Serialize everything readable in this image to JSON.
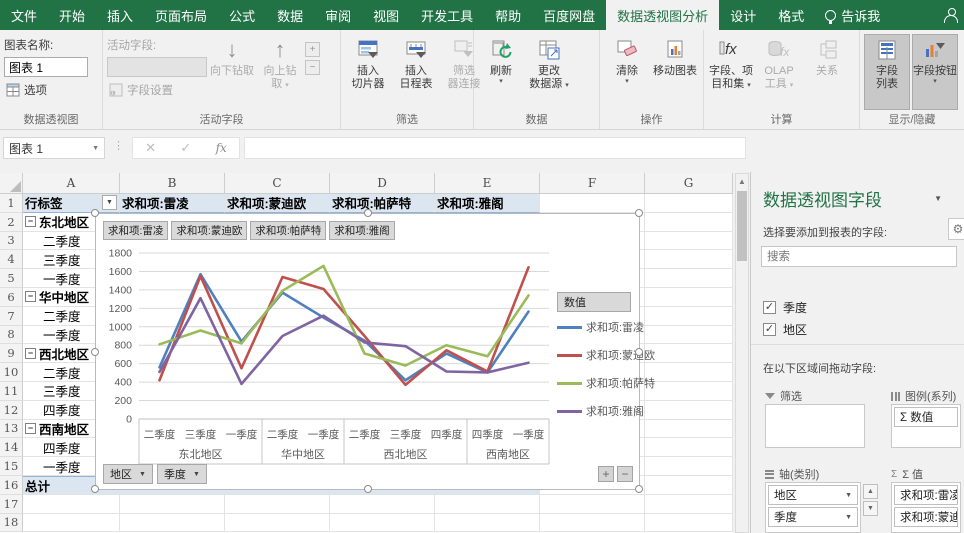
{
  "titlebar": {
    "tabs": [
      {
        "label": "文件",
        "active": false
      },
      {
        "label": "开始",
        "active": false
      },
      {
        "label": "插入",
        "active": false
      },
      {
        "label": "页面布局",
        "active": false
      },
      {
        "label": "公式",
        "active": false
      },
      {
        "label": "数据",
        "active": false
      },
      {
        "label": "审阅",
        "active": false
      },
      {
        "label": "视图",
        "active": false
      },
      {
        "label": "开发工具",
        "active": false
      },
      {
        "label": "帮助",
        "active": false
      },
      {
        "label": "百度网盘",
        "active": false
      },
      {
        "label": "数据透视图分析",
        "active": true
      },
      {
        "label": "设计",
        "active": false
      },
      {
        "label": "格式",
        "active": false
      }
    ],
    "tell_me": "告诉我"
  },
  "ribbon": {
    "pivotchart_group": {
      "label": "数据透视图",
      "chart_name_label": "图表名称:",
      "chart_name": "图表 1",
      "options": "选项"
    },
    "active_field_group": {
      "label": "活动字段",
      "field_label": "活动字段:",
      "field_settings": "字段设置",
      "drill_down": "向下钻取",
      "drill_up_1": "向上钻",
      "drill_up_2": "取"
    },
    "filter_group": {
      "label": "筛选",
      "insert_slicer_1": "插入",
      "insert_slicer_2": "切片器",
      "insert_timeline_1": "插入",
      "insert_timeline_2": "日程表",
      "filter_connections_1": "筛选",
      "filter_connections_2": "器连接"
    },
    "data_group": {
      "label": "数据",
      "refresh": "刷新",
      "change_source_1": "更改",
      "change_source_2": "数据源"
    },
    "actions_group": {
      "label": "操作",
      "clear": "清除",
      "move_chart": "移动图表"
    },
    "calc_group": {
      "label": "计算",
      "fields_items_1": "字段、项",
      "fields_items_2": "目和集",
      "olap_1": "OLAP",
      "olap_2": "工具",
      "relationships": "关系"
    },
    "show_hide_group": {
      "label": "显示/隐藏",
      "field_list_1": "字段",
      "field_list_2": "列表",
      "field_buttons_1": "字段按钮"
    }
  },
  "formula_bar": {
    "name_box": "图表 1"
  },
  "sheet": {
    "columns": [
      "A",
      "B",
      "C",
      "D",
      "E",
      "F",
      "G"
    ],
    "header_row": {
      "num": "1",
      "row_label": "行标签",
      "value_headers": [
        "求和项:雷凌",
        "求和项:蒙迪欧",
        "求和项:帕萨特",
        "求和项:雅阁"
      ]
    },
    "rows": [
      {
        "num": "2",
        "label": "东北地区",
        "type": "group"
      },
      {
        "num": "3",
        "label": "二季度",
        "type": "item"
      },
      {
        "num": "4",
        "label": "三季度",
        "type": "item"
      },
      {
        "num": "5",
        "label": "一季度",
        "type": "item"
      },
      {
        "num": "6",
        "label": "华中地区",
        "type": "group"
      },
      {
        "num": "7",
        "label": "二季度",
        "type": "item"
      },
      {
        "num": "8",
        "label": "一季度",
        "type": "item"
      },
      {
        "num": "9",
        "label": "西北地区",
        "type": "group"
      },
      {
        "num": "10",
        "label": "二季度",
        "type": "item"
      },
      {
        "num": "11",
        "label": "三季度",
        "type": "item"
      },
      {
        "num": "12",
        "label": "四季度",
        "type": "item"
      },
      {
        "num": "13",
        "label": "西南地区",
        "type": "group"
      },
      {
        "num": "14",
        "label": "四季度",
        "type": "item"
      },
      {
        "num": "15",
        "label": "一季度",
        "type": "item"
      },
      {
        "num": "16",
        "label": "总计",
        "type": "grand"
      },
      {
        "num": "17",
        "label": "",
        "type": "empty"
      },
      {
        "num": "18",
        "label": "",
        "type": "empty"
      }
    ]
  },
  "chart": {
    "field_buttons": [
      "求和项:雷凌",
      "求和项:蒙迪欧",
      "求和项:帕萨特",
      "求和项:雅阁"
    ],
    "axis_field_buttons": [
      "地区",
      "季度"
    ],
    "legend_header": "数值",
    "expand_button": "+",
    "collapse_button": "−"
  },
  "chart_data": {
    "type": "line",
    "title": "",
    "xlabel": "",
    "ylabel": "",
    "ylim": [
      0,
      1800
    ],
    "y_ticks": [
      0,
      200,
      400,
      600,
      800,
      1000,
      1200,
      1400,
      1600,
      1800
    ],
    "grid": true,
    "legend_position": "right",
    "groups": [
      {
        "label": "东北地区",
        "categories": [
          "二季度",
          "三季度",
          "一季度"
        ]
      },
      {
        "label": "华中地区",
        "categories": [
          "二季度",
          "一季度"
        ]
      },
      {
        "label": "西北地区",
        "categories": [
          "二季度",
          "三季度",
          "四季度"
        ]
      },
      {
        "label": "西南地区",
        "categories": [
          "四季度",
          "一季度"
        ]
      }
    ],
    "series": [
      {
        "name": "求和项:雷凌",
        "color": "#4F81BD",
        "values": [
          560,
          1570,
          840,
          1370,
          1100,
          850,
          420,
          710,
          505,
          1165
        ]
      },
      {
        "name": "求和项:蒙迪欧",
        "color": "#C0504D",
        "values": [
          420,
          1550,
          550,
          1540,
          1410,
          900,
          370,
          745,
          515,
          1645
        ]
      },
      {
        "name": "求和项:帕萨特",
        "color": "#9BBB59",
        "values": [
          810,
          960,
          820,
          1390,
          1660,
          710,
          580,
          800,
          680,
          1340
        ]
      },
      {
        "name": "求和项:雅阁",
        "color": "#8064A2",
        "values": [
          510,
          1310,
          380,
          900,
          1120,
          830,
          790,
          515,
          505,
          610
        ]
      }
    ]
  },
  "panel": {
    "title": "数据透视图字段",
    "subtitle": "选择要添加到报表的字段:",
    "search_placeholder": "搜索",
    "fields": [
      {
        "label": "季度",
        "checked": true
      },
      {
        "label": "地区",
        "checked": true
      }
    ],
    "drag_label": "在以下区域间拖动字段:",
    "areas": {
      "filters": {
        "label": "筛选",
        "items": []
      },
      "legend": {
        "label": "图例(系列)",
        "items": [
          "Σ 数值"
        ]
      },
      "axis": {
        "label": "轴(类别)",
        "items": [
          "地区",
          "季度"
        ]
      },
      "values": {
        "label": "Σ 值",
        "items": [
          "求和项:雷凌",
          "求和项:蒙迪欧"
        ]
      }
    }
  },
  "colors": {
    "ribbon_green": "#217346",
    "pivot_fill": "#DCE6F1",
    "series": [
      "#4F81BD",
      "#C0504D",
      "#9BBB59",
      "#8064A2"
    ]
  }
}
